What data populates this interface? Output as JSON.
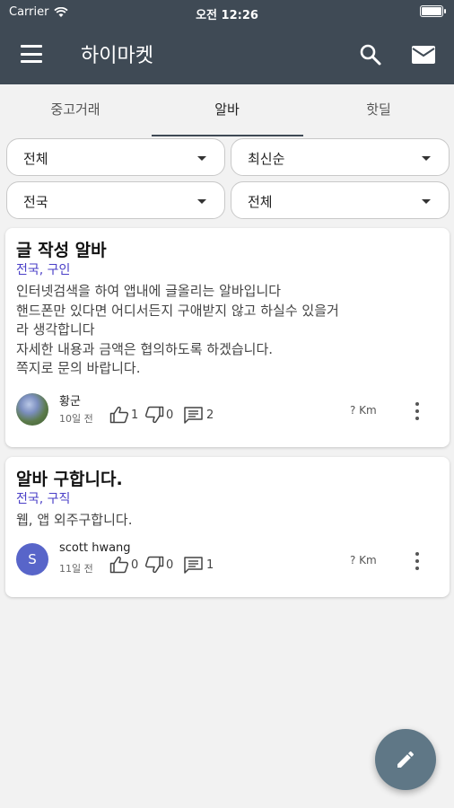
{
  "status_bar": {
    "carrier": "Carrier",
    "time": "오전 12:26"
  },
  "app_bar": {
    "title": "하이마켓",
    "background_color": "#3f4a55",
    "icons": [
      "menu-icon",
      "search-icon",
      "mail-icon"
    ]
  },
  "tabs": [
    {
      "label": "중고거래",
      "selected": false
    },
    {
      "label": "알바",
      "selected": true
    },
    {
      "label": "핫딜",
      "selected": false
    }
  ],
  "filters": {
    "category": "전체",
    "sort": "최신순",
    "region": "전국",
    "type": "전체"
  },
  "posts": [
    {
      "title": "글 작성 알바",
      "tags": "전국, 구인",
      "body_lines": [
        "인터넷검색을 하여 앱내에 글올리는 알바입니다",
        "핸드폰만 있다면 어디서든지 구애받지 않고 하실수 있을거",
        "라 생각합니다",
        "자세한 내용과 금액은 협의하도록 하겠습니다.",
        "쪽지로 문의 바랍니다."
      ],
      "author": "황군",
      "time_ago": "10일 전",
      "likes": "1",
      "dislikes": "0",
      "comments": "2",
      "distance": "? Km"
    },
    {
      "title": "알바 구합니다.",
      "tags": "전국, 구직",
      "body_lines": [
        "웹, 앱 외주구합니다."
      ],
      "author": "scott hwang",
      "avatar_letter": "S",
      "time_ago": "11일 전",
      "likes": "0",
      "dislikes": "0",
      "comments": "1",
      "distance": "? Km"
    }
  ],
  "colors": {
    "tag_color": "#4a3fc7",
    "fab_color": "#5f7786",
    "avatar_color": "#5865c9"
  }
}
